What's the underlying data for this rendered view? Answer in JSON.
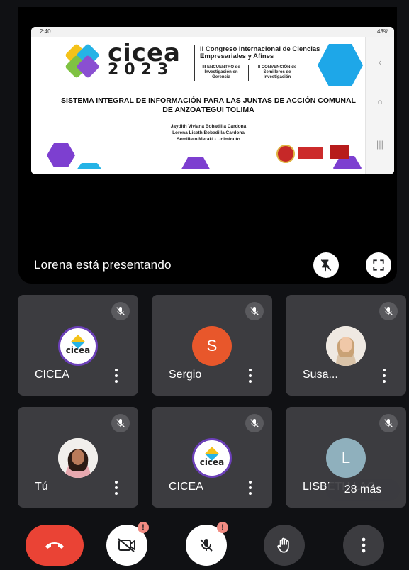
{
  "presentation": {
    "status_label": "Lorena está presentando",
    "phone_status_time": "2:40",
    "phone_status_right": "43%",
    "slide": {
      "logo_word": "cicea",
      "logo_year": "2023",
      "congress_title": "II Congreso Internacional de Ciencias Empresariales y Afines",
      "sub_left": "III ENCUENTRO de Investigación en Gerencia",
      "sub_right": "II CONVENCIÓN de Semilleros de Investigación",
      "title": "SISTEMA INTEGRAL DE INFORMACIÓN PARA LAS JUNTAS DE ACCIÓN COMUNAL DE ANZOÁTEGUI TOLIMA",
      "authors": [
        "Jaydith Viviana Bobadilla Cardona",
        "Lorena Liseth Bobadilla Cardona",
        "Semillero Meraki - Uniminuto"
      ],
      "next_slide_logo": "cicea"
    },
    "icons": {
      "pin": "unpin-icon",
      "fullscreen": "fullscreen-icon"
    }
  },
  "participants": [
    {
      "name": "CICEA",
      "avatar": "cicea-logo",
      "avatar_text": "cicea",
      "muted": true
    },
    {
      "name": "Sergio",
      "avatar": "letter",
      "initial": "S",
      "avatar_color": "#e8572b",
      "muted": true
    },
    {
      "name": "Susa...",
      "avatar": "photo",
      "muted": true
    },
    {
      "name": "Tú",
      "avatar": "photo",
      "muted": true
    },
    {
      "name": "CICEA",
      "avatar": "cicea-logo",
      "avatar_text": "cicea",
      "muted": true
    },
    {
      "name": "LISBETH LAG",
      "avatar": "letter",
      "initial": "L",
      "avatar_color": "#8fb0bd",
      "muted": true
    }
  ],
  "more_participants_label": "28 más",
  "controls": {
    "end_call": "end-call-icon",
    "camera": "camera-off-icon",
    "mic": "mic-off-icon",
    "raise_hand": "raise-hand-icon",
    "more": "more-vertical-icon",
    "warning_badge": "!"
  },
  "colors": {
    "background": "#101114",
    "tile": "#3c3c40",
    "end_call": "#ea4335",
    "badge": "#f28b82",
    "cicea_purple": "#6b3fb8"
  }
}
